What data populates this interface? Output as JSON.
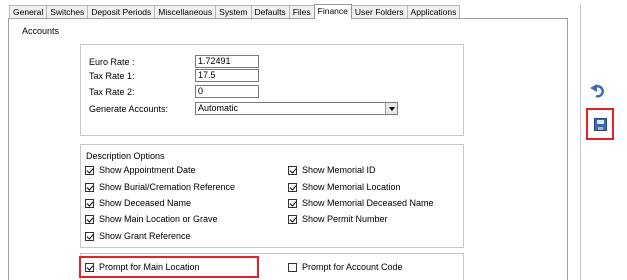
{
  "tabs": [
    {
      "label": "General"
    },
    {
      "label": "Switches"
    },
    {
      "label": "Deposit Periods"
    },
    {
      "label": "Miscellaneous"
    },
    {
      "label": "System"
    },
    {
      "label": "Defaults"
    },
    {
      "label": "Files"
    },
    {
      "label": "Finance",
      "active": true
    },
    {
      "label": "User Folders"
    },
    {
      "label": "Applications"
    }
  ],
  "panel": {
    "title": "Accounts"
  },
  "rates": {
    "euro_label": "Euro Rate :",
    "euro_value": "1.72491",
    "tax1_label": "Tax Rate 1:",
    "tax1_value": "17.5",
    "tax2_label": "Tax Rate 2:",
    "tax2_value": "0",
    "generate_label": "Generate Accounts:",
    "generate_value": "Automatic"
  },
  "description_options": {
    "title": "Description Options",
    "left": [
      {
        "label": "Show Appointment Date",
        "checked": true
      },
      {
        "label": "Show Burial/Cremation Reference",
        "checked": true
      },
      {
        "label": "Show Deceased Name",
        "checked": true
      },
      {
        "label": "Show Main Location or Grave",
        "checked": true
      },
      {
        "label": "Show Grant Reference",
        "checked": true
      }
    ],
    "right": [
      {
        "label": "Show Memorial ID",
        "checked": true
      },
      {
        "label": "Show Memorial Location",
        "checked": true
      },
      {
        "label": "Show Memorial Deceased Name",
        "checked": true
      },
      {
        "label": "Show Permit Number",
        "checked": true
      }
    ]
  },
  "prompts": {
    "main_location": {
      "label": "Prompt for Main Location",
      "checked": true
    },
    "account_code": {
      "label": "Prompt for Account Code",
      "checked": false
    }
  },
  "colors": {
    "highlight": "#e2232a",
    "save_icon": "#3c6cb0"
  },
  "icons": [
    "undo-icon",
    "save-icon",
    "chevron-down-icon"
  ]
}
